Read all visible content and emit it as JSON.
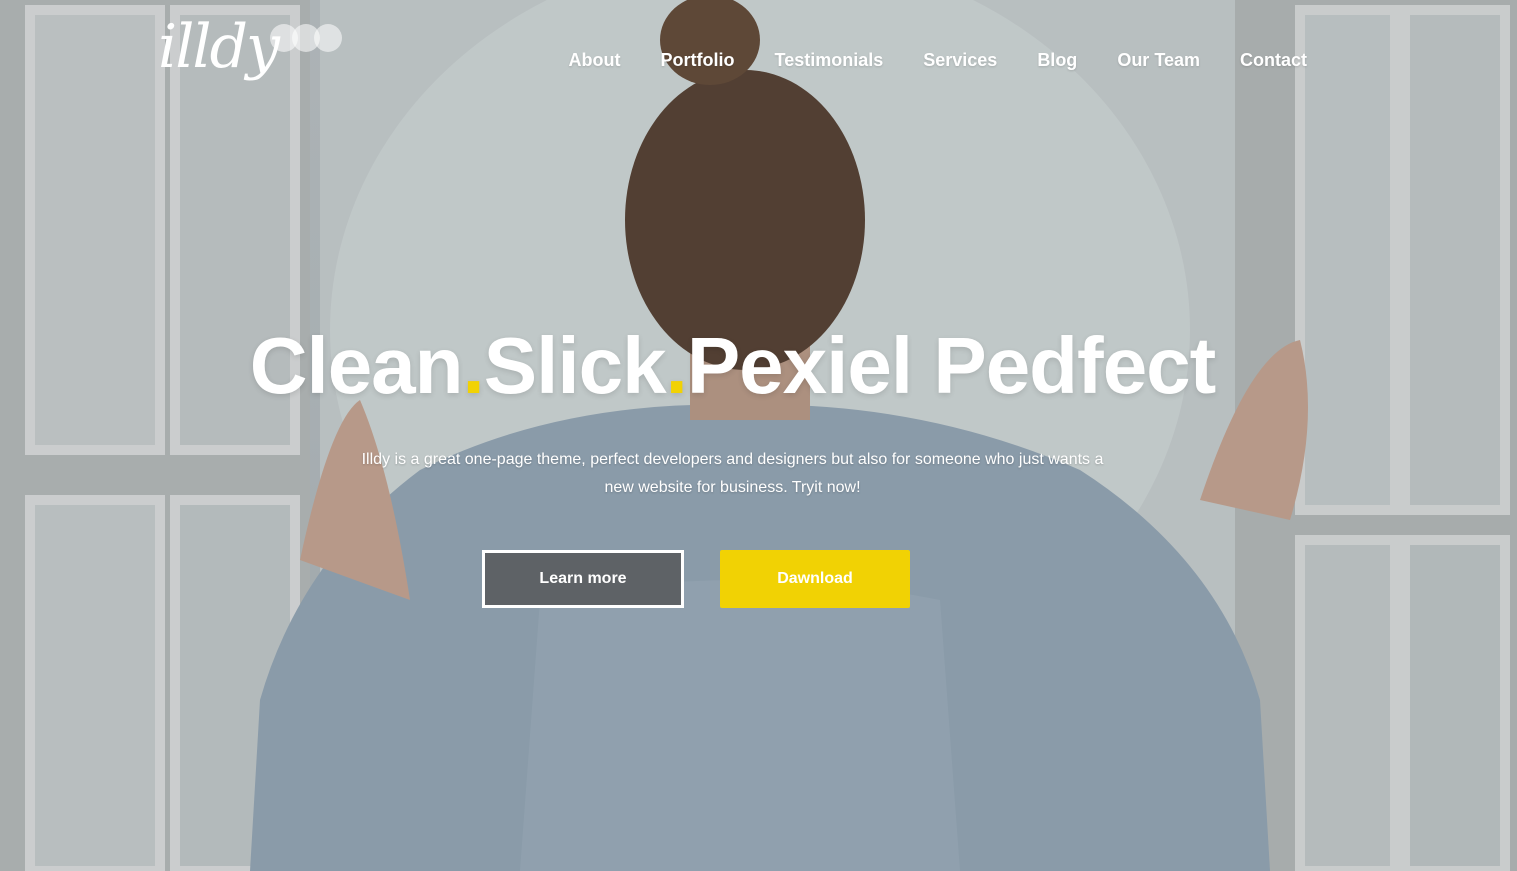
{
  "brand": {
    "logo_text": "illdy",
    "accent_color": "#f1d204"
  },
  "nav": {
    "items": [
      {
        "label": "About"
      },
      {
        "label": "Portfolio"
      },
      {
        "label": "Testimonials"
      },
      {
        "label": "Services"
      },
      {
        "label": "Blog"
      },
      {
        "label": "Our Team"
      },
      {
        "label": "Contact"
      }
    ]
  },
  "hero": {
    "title_part1": "Clean",
    "title_dot1": ".",
    "title_part2": "Slick",
    "title_dot2": ".",
    "title_part3": "Pexiel Pedfect",
    "subtitle_line1": "Illdy is a great one-page theme, perfect developers and designers but also for someone who just wants a",
    "subtitle_line2": "new website for business. Tryit now!",
    "primary_button": "Learn more",
    "secondary_button": "Dawnload"
  }
}
